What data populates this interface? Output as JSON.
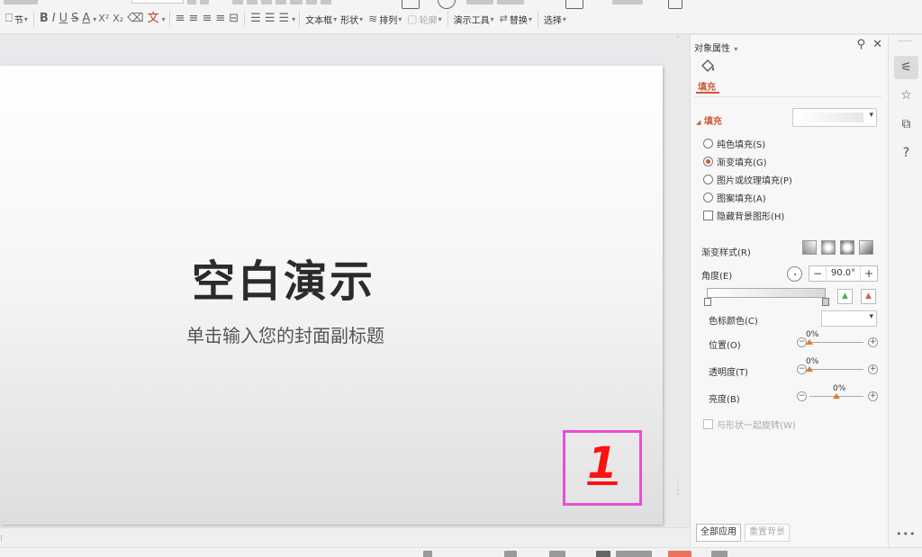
{
  "ribbon": {
    "section_label": "节",
    "font_style_buttons": [
      "B",
      "I",
      "U",
      "S",
      "A",
      "X²",
      "X₂"
    ],
    "clear_format": "⌫",
    "text_effect": "文",
    "textbox_label": "文本框",
    "shape_label": "形状",
    "arrange_label": "排列",
    "outline_label": "轮廓",
    "presentation_tools_label": "演示工具",
    "replace_label": "替换",
    "select_label": "选择"
  },
  "slide": {
    "title": "空白演示",
    "subtitle": "单击输入您的封面副标题",
    "page_number": "1"
  },
  "panel": {
    "header": "对象属性",
    "header_caret": "▾",
    "pin_icon": "⚲",
    "close_icon": "✕",
    "tab_fill": "填充",
    "section_fill": "填充",
    "fill_options": {
      "solid": "纯色填充(S)",
      "gradient": "渐变填充(G)",
      "picture": "图片或纹理填充(P)",
      "pattern": "图案填充(A)"
    },
    "hide_bg_graphics": "隐藏背景图形(H)",
    "gradient_style_label": "渐变样式(R)",
    "angle_label": "角度(E)",
    "angle_value": "90.0°",
    "stepper_minus": "−",
    "stepper_plus": "+",
    "stop_color_label": "色标颜色(C)",
    "position_label": "位置(O)",
    "position_value": "0%",
    "position_fraction": 0.0,
    "transparency_label": "透明度(T)",
    "transparency_value": "0%",
    "transparency_fraction": 0.0,
    "brightness_label": "亮度(B)",
    "brightness_value": "0%",
    "brightness_fraction": 0.5,
    "rotate_with_shape": "与形状一起旋转(W)",
    "apply_all": "全部应用",
    "reset_bg": "重置背景",
    "slider_minus": "−",
    "slider_plus": "+"
  },
  "rail": {
    "more_icon": "•••"
  },
  "colors": {
    "accent": "#d0573d",
    "slider_thumb": "#e07b2c",
    "page_number": "#ff1010",
    "highlight_box": "#e44fd6"
  }
}
